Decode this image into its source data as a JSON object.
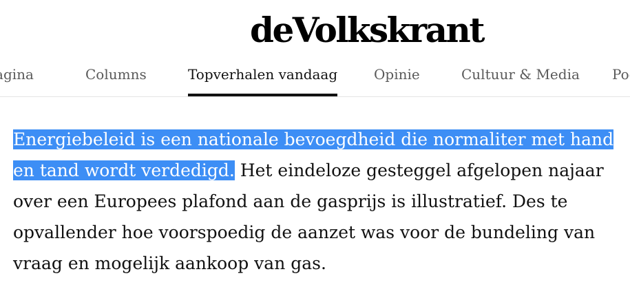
{
  "header": {
    "logo_text": "deVolkskrant"
  },
  "nav": {
    "items": [
      {
        "label": "Voorpagina"
      },
      {
        "label": "Columns"
      },
      {
        "label": "Topverhalen vandaag",
        "active": true
      },
      {
        "label": "Opinie"
      },
      {
        "label": "Cultuur & Media"
      },
      {
        "label": "Podcasts"
      }
    ]
  },
  "article": {
    "selected_text": "Energiebeleid is een nationale bevoegdheid die normaliter met hand en tand wordt verdedigd.",
    "rest_text": " Het eindeloze gesteggel afgelopen najaar over een Europees plafond aan de gasprijs is illustratief. Des te opvallender hoe voorspoedig de aanzet was voor de bundeling van vraag en mogelijk aankoop van gas."
  },
  "colors": {
    "selection_highlight": "#3d8ef5",
    "text": "#111111",
    "nav_inactive": "#5a5a5a"
  }
}
